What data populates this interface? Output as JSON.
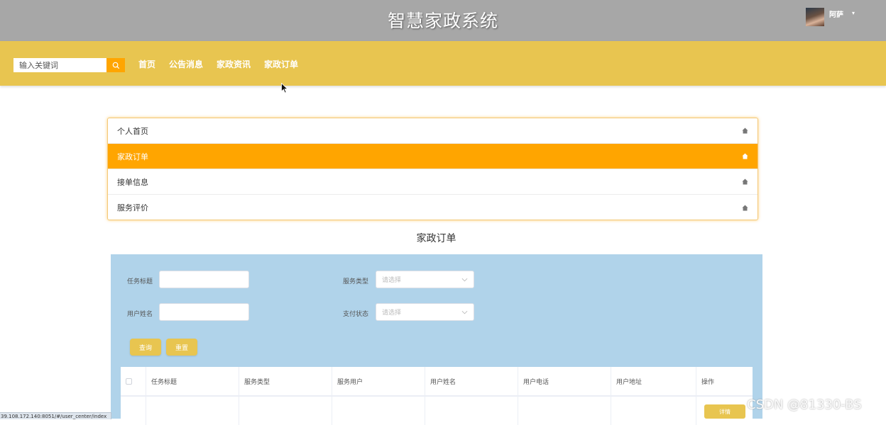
{
  "header": {
    "site_title": "智慧家政系统",
    "user_name": "阿萨",
    "caret": "▾"
  },
  "navbar": {
    "search_placeholder": "输入关键词",
    "links": [
      "首页",
      "公告消息",
      "家政资讯",
      "家政订单"
    ]
  },
  "side_menu": {
    "items": [
      {
        "label": "个人首页",
        "active": false
      },
      {
        "label": "家政订单",
        "active": true
      },
      {
        "label": "接单信息",
        "active": false
      },
      {
        "label": "服务评价",
        "active": false
      }
    ]
  },
  "page": {
    "title": "家政订单"
  },
  "filters": {
    "task_title_label": "任务标题",
    "service_type_label": "服务类型",
    "service_type_placeholder": "请选择",
    "user_name_label": "用户姓名",
    "pay_status_label": "支付状态",
    "pay_status_placeholder": "请选择",
    "query_button": "查询",
    "reset_button": "重置"
  },
  "table": {
    "columns": [
      "任务标题",
      "服务类型",
      "服务用户",
      "用户姓名",
      "用户电话",
      "用户地址",
      "操作"
    ],
    "detail_button": "详情"
  },
  "statusbar": {
    "url": "39.108.172.140:8051/#/user_center/index"
  },
  "watermark": "CSDN @81330-BS",
  "colors": {
    "header_bg": "#a7a7a7",
    "navbar_bg": "#e8c550",
    "accent": "#ffa500",
    "panel_bg": "#b0d3ea"
  }
}
